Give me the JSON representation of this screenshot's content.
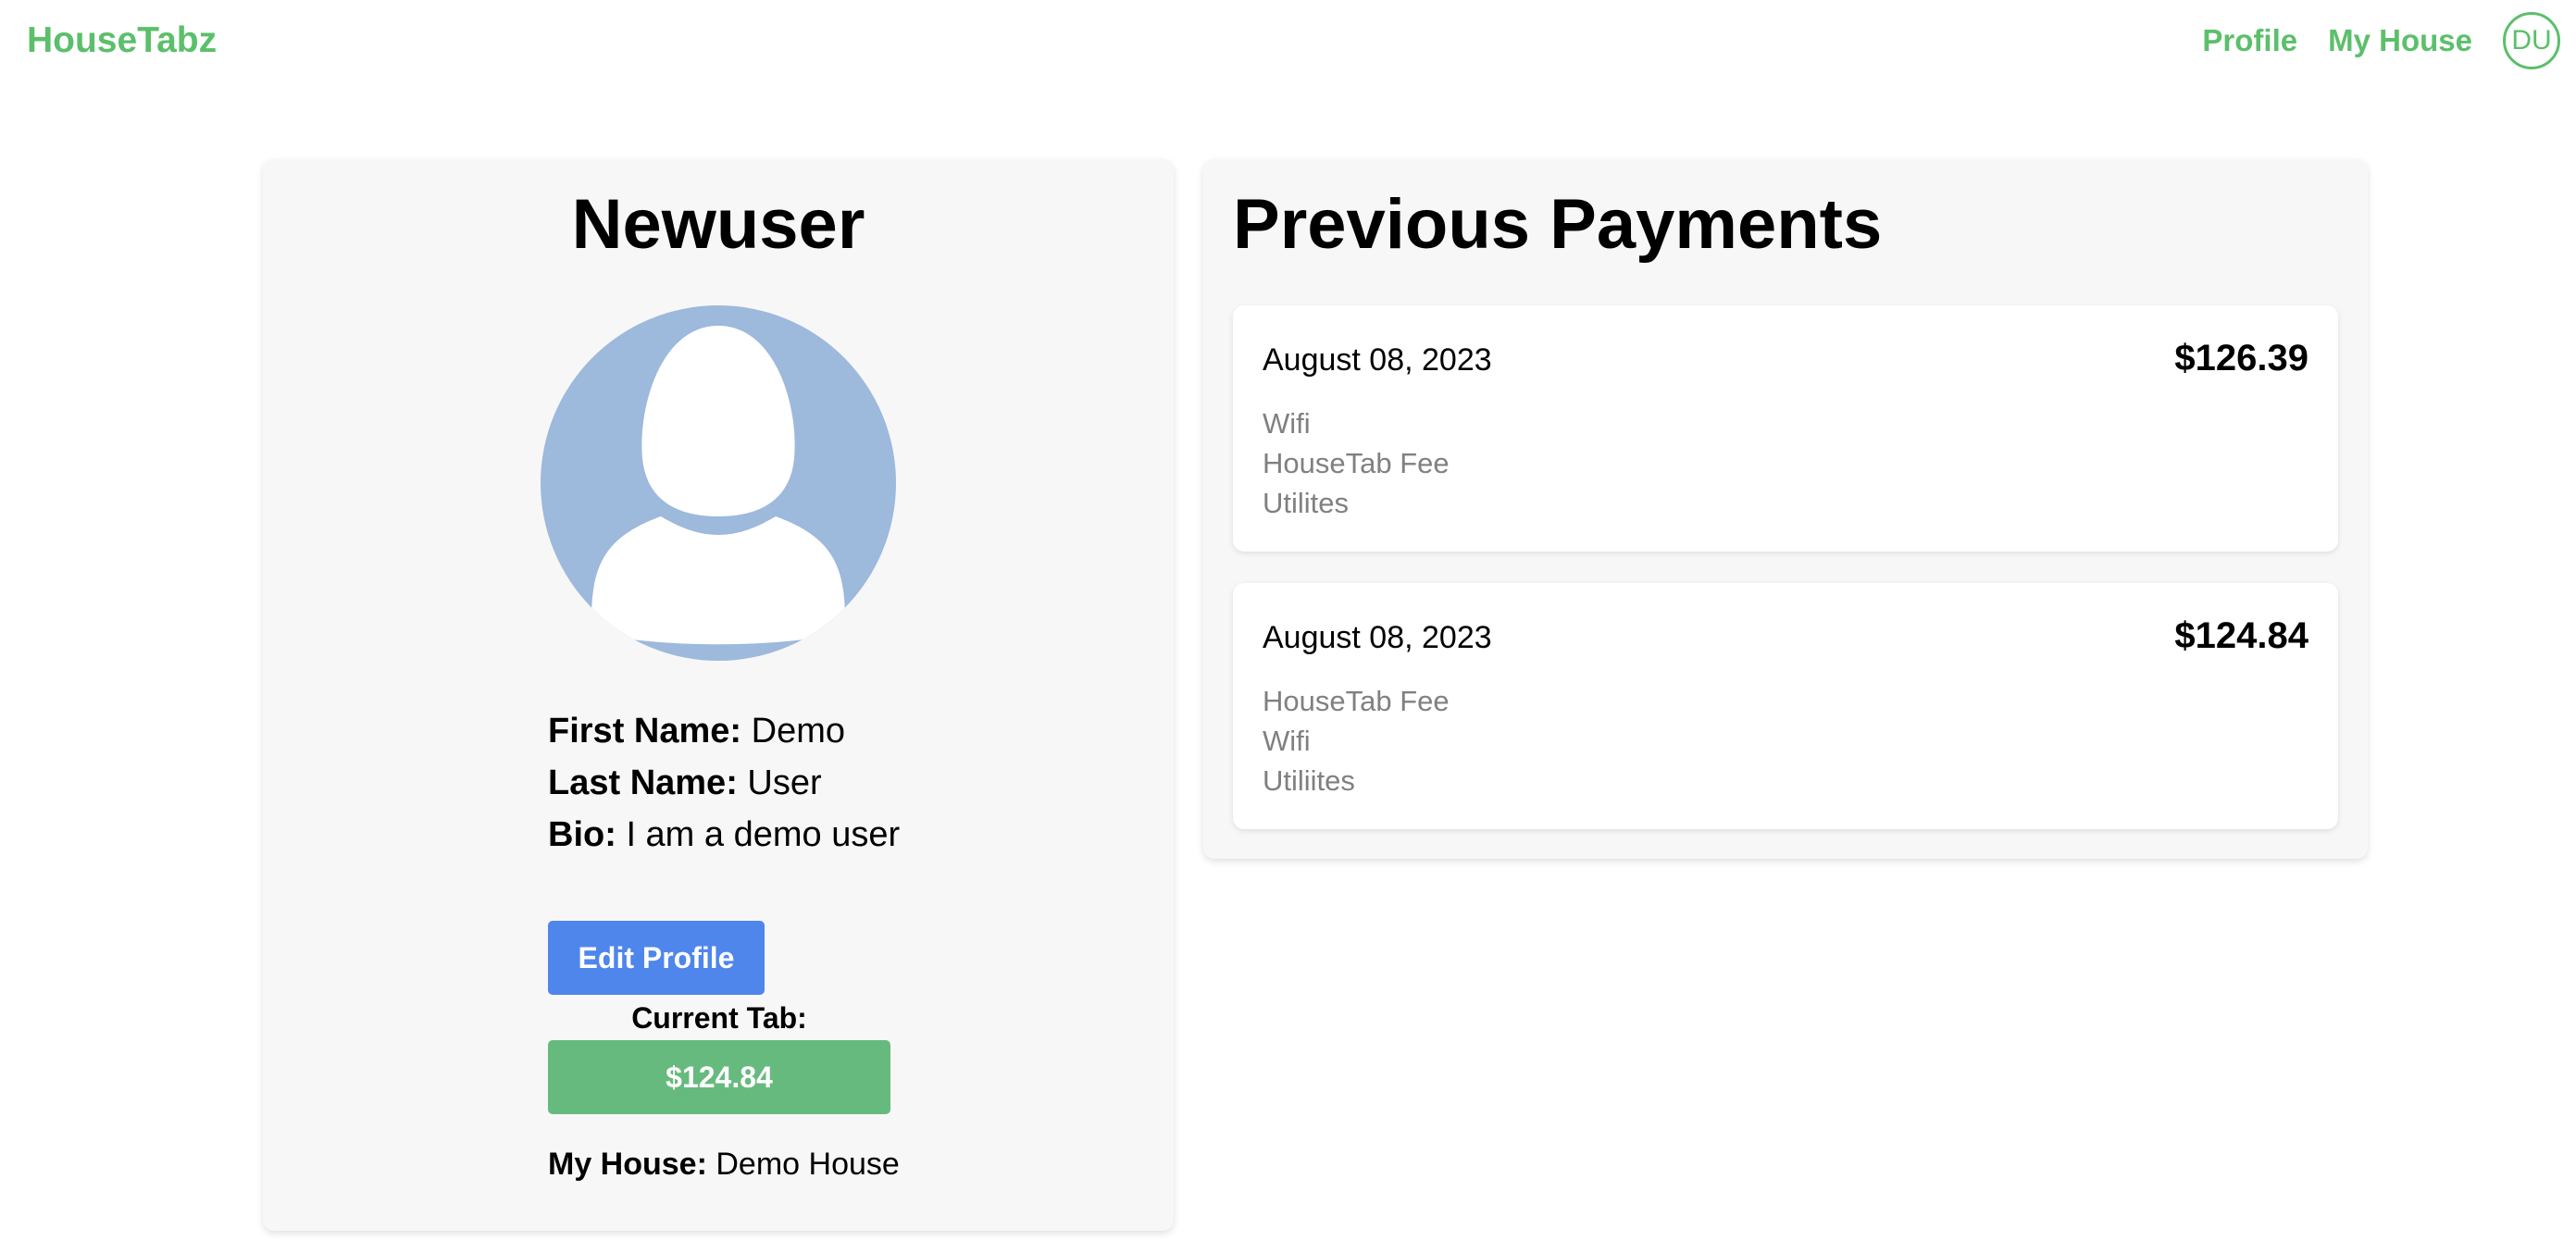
{
  "nav": {
    "brand": "HouseTabz",
    "links": [
      "Profile",
      "My House"
    ],
    "avatar_initials": "DU",
    "accent_color": "#5cbf6b"
  },
  "profile": {
    "username": "Newuser",
    "avatar_icon": "user-silhouette-icon",
    "first_name_label": "First Name:",
    "first_name": "Demo",
    "last_name_label": "Last Name:",
    "last_name": "User",
    "bio_label": "Bio:",
    "bio": "I am a demo user",
    "edit_button": "Edit Profile",
    "current_tab_label": "Current Tab:",
    "current_tab": "$124.84",
    "house_label": "My House:",
    "house": "Demo House"
  },
  "payments": {
    "title": "Previous Payments",
    "list": [
      {
        "date": "August 08, 2023",
        "amount": "$126.39",
        "items": [
          "Wifi",
          "HouseTab Fee",
          "Utilites"
        ]
      },
      {
        "date": "August 08, 2023",
        "amount": "$124.84",
        "items": [
          "HouseTab Fee",
          "Wifi",
          "Utiliites"
        ]
      }
    ]
  },
  "colors": {
    "edit_button": "#4f86ec",
    "tab_badge": "#67ba7e",
    "avatar_background": "#9db9dc"
  }
}
